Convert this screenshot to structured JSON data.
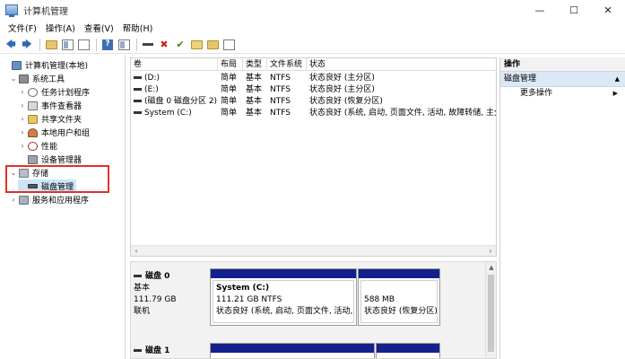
{
  "window": {
    "title": "计算机管理",
    "controls": {
      "minimize": "—",
      "maximize": "☐",
      "close": "✕"
    }
  },
  "menu": [
    "文件(F)",
    "操作(A)",
    "查看(V)",
    "帮助(H)"
  ],
  "toolbar": {
    "back": "🡄",
    "forward": "🡆",
    "help": "?",
    "delete": "✖",
    "check": "✔"
  },
  "tree": {
    "items": [
      {
        "label": "计算机管理(本地)",
        "toggle": "",
        "icon": "computer-icon"
      },
      {
        "label": "系统工具",
        "toggle": "⌄",
        "icon": "tools-icon"
      },
      {
        "label": "任务计划程序",
        "toggle": "›",
        "icon": "clock-icon"
      },
      {
        "label": "事件查看器",
        "toggle": "›",
        "icon": "event-viewer-icon"
      },
      {
        "label": "共享文件夹",
        "toggle": "›",
        "icon": "shared-folder-icon"
      },
      {
        "label": "本地用户和组",
        "toggle": "›",
        "icon": "users-icon"
      },
      {
        "label": "性能",
        "toggle": "›",
        "icon": "performance-icon"
      },
      {
        "label": "设备管理器",
        "toggle": "",
        "icon": "device-manager-icon"
      },
      {
        "label": "存储",
        "toggle": "⌄",
        "icon": "storage-icon"
      },
      {
        "label": "磁盘管理",
        "toggle": "",
        "icon": "disk-icon"
      },
      {
        "label": "服务和应用程序",
        "toggle": "›",
        "icon": "services-icon"
      }
    ]
  },
  "volume_table": {
    "columns": [
      "卷",
      "布局",
      "类型",
      "文件系统",
      "状态"
    ],
    "rows": [
      [
        "(D:)",
        "简单",
        "基本",
        "NTFS",
        "状态良好 (主分区)"
      ],
      [
        "(E:)",
        "简单",
        "基本",
        "NTFS",
        "状态良好 (主分区)"
      ],
      [
        "(磁盘 0 磁盘分区 2)",
        "简单",
        "基本",
        "NTFS",
        "状态良好 (恢复分区)"
      ],
      [
        "System (C:)",
        "简单",
        "基本",
        "NTFS",
        "状态良好 (系统, 启动, 页面文件, 活动, 故障转储, 主分"
      ]
    ],
    "scroll_left": "‹",
    "scroll_right": "›"
  },
  "disks": [
    {
      "name": "磁盘 0",
      "type": "基本",
      "size": "111.79 GB",
      "status": "联机",
      "partitions": [
        {
          "name": "System  (C:)",
          "size": "111.21 GB NTFS",
          "status": "状态良好 (系统, 启动, 页面文件, 活动, 故"
        },
        {
          "name": "",
          "size": "588 MB",
          "status": "状态良好 (恢复分区)"
        }
      ]
    },
    {
      "name": "磁盘 1",
      "type": "",
      "size": "",
      "status": "",
      "partitions": []
    }
  ],
  "actions": {
    "header": "操作",
    "section": "磁盘管理",
    "more": "更多操作",
    "up_caret": "▲",
    "right_caret": "▶"
  },
  "colors": {
    "partition_bar": "#14218c",
    "selection": "#cde6f7",
    "highlight_border": "#e0302b"
  }
}
